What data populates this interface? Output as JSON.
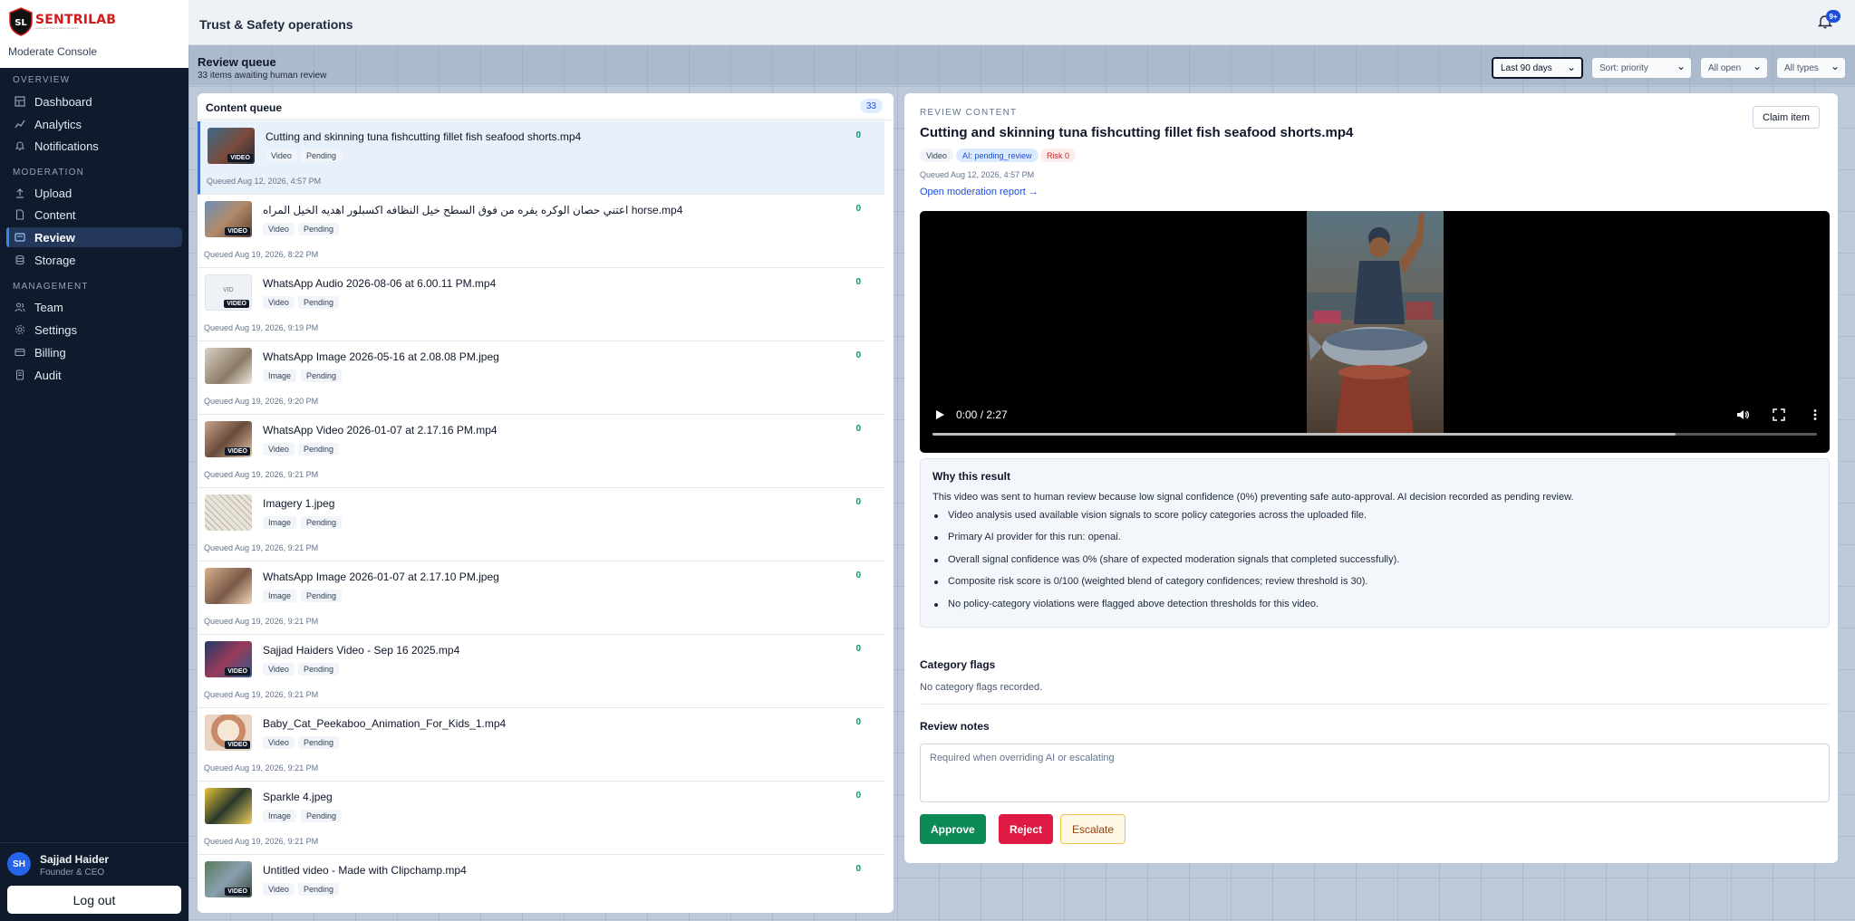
{
  "brand": {
    "logo_text": "SENTRILAB",
    "logo_initials": "SL",
    "logo_tagline": "A Personal Trust & Safety Company",
    "console_name": "Moderate Console"
  },
  "nav": {
    "sections": [
      {
        "label": "OVERVIEW",
        "items": [
          {
            "label": "Dashboard",
            "icon": "dashboard-icon"
          },
          {
            "label": "Analytics",
            "icon": "analytics-icon"
          },
          {
            "label": "Notifications",
            "icon": "bell-icon"
          }
        ]
      },
      {
        "label": "MODERATION",
        "items": [
          {
            "label": "Upload",
            "icon": "upload-icon"
          },
          {
            "label": "Content",
            "icon": "document-icon"
          },
          {
            "label": "Review",
            "icon": "review-icon",
            "active": true
          },
          {
            "label": "Storage",
            "icon": "storage-icon"
          }
        ]
      },
      {
        "label": "MANAGEMENT",
        "items": [
          {
            "label": "Team",
            "icon": "team-icon"
          },
          {
            "label": "Settings",
            "icon": "gear-icon"
          },
          {
            "label": "Billing",
            "icon": "billing-icon"
          },
          {
            "label": "Audit",
            "icon": "audit-icon"
          }
        ]
      }
    ]
  },
  "user": {
    "initials": "SH",
    "name": "Sajjad Haider",
    "role": "Founder & CEO",
    "logout_label": "Log out"
  },
  "topbar": {
    "title": "Trust & Safety operations",
    "notification_badge": "9+"
  },
  "page": {
    "title": "Review queue",
    "subtitle": "33 items awaiting human review",
    "filters": [
      {
        "label": "Last 90 days"
      },
      {
        "label": "Sort: priority"
      },
      {
        "label": "All open"
      },
      {
        "label": "All types"
      }
    ]
  },
  "queue": {
    "title": "Content queue",
    "count": "33",
    "items": [
      {
        "name": "Cutting and skinning tuna fishcutting fillet fish seafood shorts.mp4",
        "type": "Video",
        "status": "Pending",
        "score": "0",
        "queued": "Queued Aug 12, 2026, 4:57 PM",
        "thumb_label": "VIDEO",
        "selected": true,
        "thumb": "tuna"
      },
      {
        "name": "اعتني حصان الوكره يفره من فوق السطح خيل النظافه اكسبلور اهديه الخيل المراه horse.mp4",
        "type": "Video",
        "status": "Pending",
        "score": "0",
        "queued": "Queued Aug 19, 2026, 8:22 PM",
        "thumb_label": "VIDEO",
        "thumb": "horse"
      },
      {
        "name": "WhatsApp Audio 2026-08-06 at 6.00.11 PM.mp4",
        "type": "Video",
        "status": "Pending",
        "score": "0",
        "queued": "Queued Aug 19, 2026, 9:19 PM",
        "thumb_label": "VIDEO",
        "thumb_placeholder": "VID",
        "thumb": "blank"
      },
      {
        "name": "WhatsApp Image 2026-05-16 at 2.08.08 PM.jpeg",
        "type": "Image",
        "status": "Pending",
        "score": "0",
        "queued": "Queued Aug 19, 2026, 9:20 PM",
        "thumb": "sketch"
      },
      {
        "name": "WhatsApp Video 2026-01-07 at 2.17.16 PM.mp4",
        "type": "Video",
        "status": "Pending",
        "score": "0",
        "queued": "Queued Aug 19, 2026, 9:21 PM",
        "thumb_label": "VIDEO",
        "thumb": "street"
      },
      {
        "name": "Imagery 1.jpeg",
        "type": "Image",
        "status": "Pending",
        "score": "0",
        "queued": "Queued Aug 19, 2026, 9:21 PM",
        "thumb": "drawing"
      },
      {
        "name": "WhatsApp Image 2026-01-07 at 2.17.10 PM.jpeg",
        "type": "Image",
        "status": "Pending",
        "score": "0",
        "queued": "Queued Aug 19, 2026, 9:21 PM",
        "thumb": "street2"
      },
      {
        "name": "Sajjad Haiders Video - Sep 16 2025.mp4",
        "type": "Video",
        "status": "Pending",
        "score": "0",
        "queued": "Queued Aug 19, 2026, 9:21 PM",
        "thumb_label": "VIDEO",
        "thumb": "stage"
      },
      {
        "name": "Baby_Cat_Peekaboo_Animation_For_Kids_1.mp4",
        "type": "Video",
        "status": "Pending",
        "score": "0",
        "queued": "Queued Aug 19, 2026, 9:21 PM",
        "thumb_label": "VIDEO",
        "thumb": "cat"
      },
      {
        "name": "Sparkle 4.jpeg",
        "type": "Image",
        "status": "Pending",
        "score": "0",
        "queued": "Queued Aug 19, 2026, 9:21 PM",
        "thumb": "sparkle"
      },
      {
        "name": "Untitled video - Made with Clipchamp.mp4",
        "type": "Video",
        "status": "Pending",
        "score": "0",
        "queued": "",
        "thumb_label": "VIDEO",
        "thumb": "clip"
      }
    ]
  },
  "detail": {
    "eyebrow": "REVIEW CONTENT",
    "claim_label": "Claim item",
    "title": "Cutting and skinning tuna fishcutting fillet fish seafood shorts.mp4",
    "pills": {
      "type": "Video",
      "ai": "AI: pending_review",
      "risk": "Risk 0"
    },
    "queued": "Queued Aug 12, 2026, 4:57 PM",
    "report_link": "Open moderation report →",
    "video": {
      "time": "0:00 / 2:27",
      "buffered_fraction": 0.84
    },
    "why": {
      "title": "Why this result",
      "lead": "This video was sent to human review because low signal confidence (0%) preventing safe auto-approval. AI decision recorded as pending review.",
      "points": [
        "Video analysis used available vision signals to score policy categories across the uploaded file.",
        "Primary AI provider for this run: openai.",
        "Overall signal confidence was 0% (share of expected moderation signals that completed successfully).",
        "Composite risk score is 0/100 (weighted blend of category confidences; review threshold is 30).",
        "No policy-category violations were flagged above detection thresholds for this video."
      ]
    },
    "category_flags": {
      "title": "Category flags",
      "empty": "No category flags recorded."
    },
    "notes": {
      "title": "Review notes",
      "placeholder": "Required when overriding AI or escalating"
    },
    "actions": {
      "approve": "Approve",
      "reject": "Reject",
      "escalate": "Escalate"
    }
  }
}
